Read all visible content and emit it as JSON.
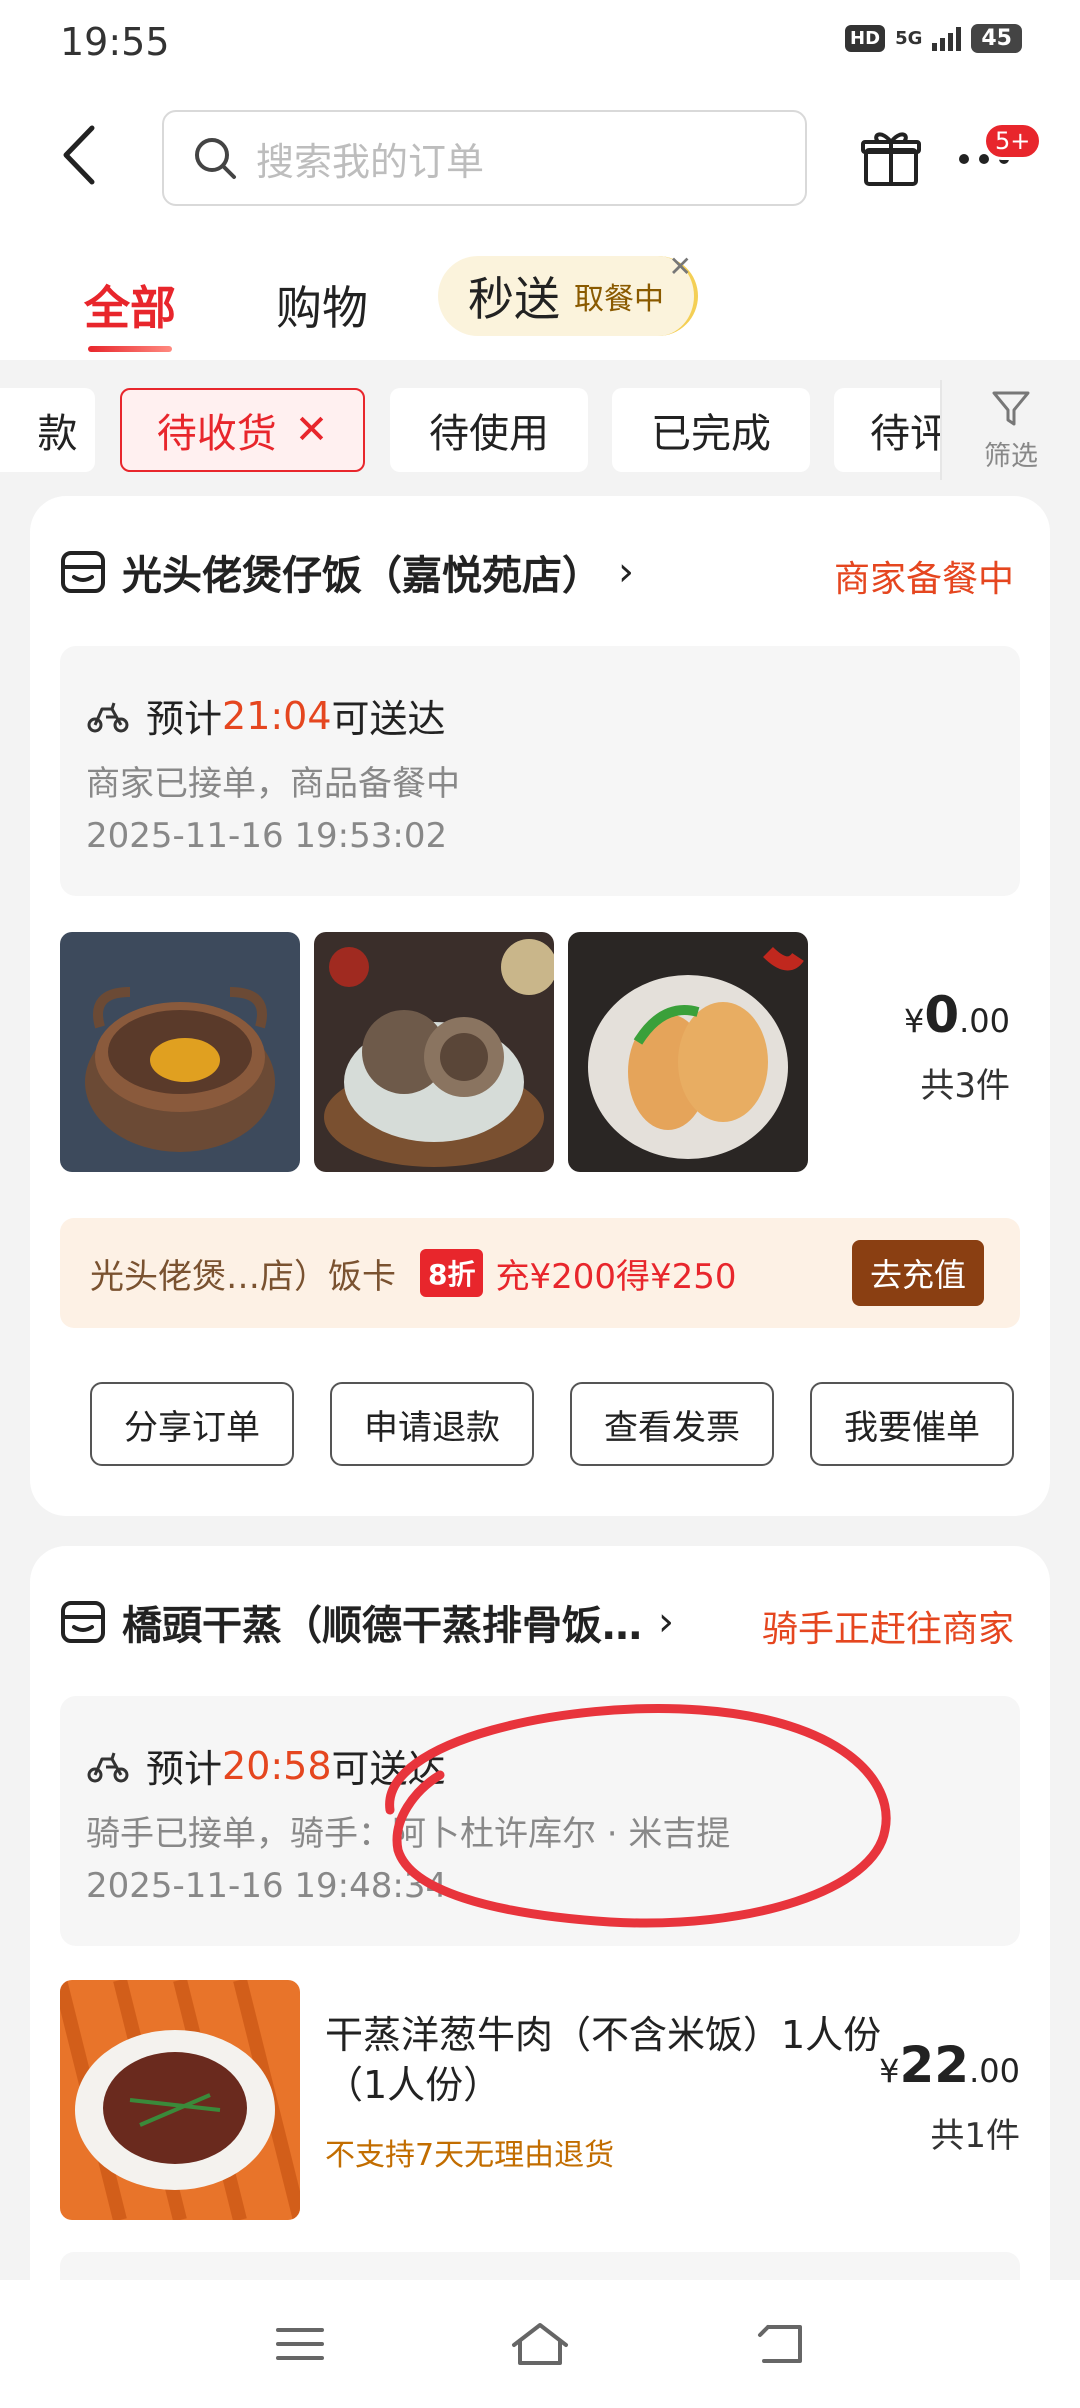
{
  "status_bar": {
    "time": "19:55",
    "hd": "HD",
    "network": "5G",
    "battery": "45"
  },
  "header": {
    "search_placeholder": "搜索我的订单"
  },
  "more_badge": "5+",
  "tabs": {
    "all": "全部",
    "shopping": "购物",
    "express": "秒送",
    "express_sub": "取餐中"
  },
  "filters": [
    "款",
    "待收货",
    "待使用",
    "已完成",
    "待评"
  ],
  "filter_button": "筛选",
  "orders": [
    {
      "shop": "光头佬煲仔饭（嘉悦苑店）",
      "status": "商家备餐中",
      "eta_prefix": "预计",
      "eta_time": "21:04",
      "eta_suffix": "可送达",
      "detail": "商家已接单，商品备餐中",
      "time": "2025-11-16 19:53:02",
      "price_currency": "¥",
      "price_int": "0",
      "price_dec": ".00",
      "count": "共3件",
      "promo": {
        "name": "光头佬煲…店）饭卡",
        "discount": "8折",
        "offer": "充¥200得¥250",
        "button": "去充值"
      },
      "actions": [
        "分享订单",
        "申请退款",
        "查看发票",
        "我要催单"
      ]
    },
    {
      "shop": "橋頭干蒸（顺德干蒸排骨饭…",
      "status": "骑手正赶往商家",
      "eta_prefix": "预计",
      "eta_time": "20:58",
      "eta_suffix": "可送达",
      "detail": "骑手已接单，骑手：阿卜杜许库尔 · 米吉提",
      "time": "2025-11-16 19:48:34",
      "item_title": "干蒸洋葱牛肉（不含米饭）1人份（1人份）",
      "item_note": "不支持7天无理由退货",
      "price_currency": "¥",
      "price_int": "22",
      "price_dec": ".00",
      "count": "共1件"
    }
  ],
  "colors": {
    "accent_red": "#e8262c",
    "status_orange": "#e5461f",
    "annotation_red": "#e8343c"
  }
}
